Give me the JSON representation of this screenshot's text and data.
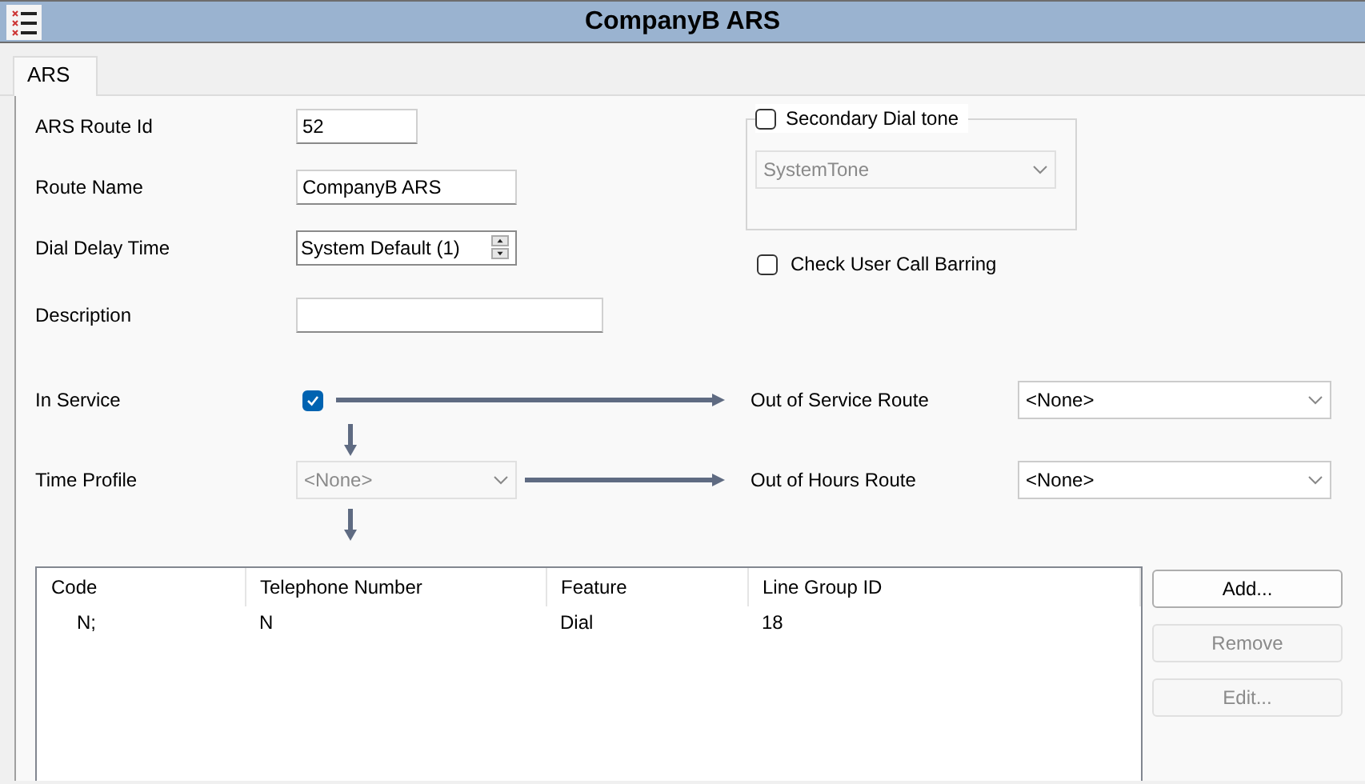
{
  "window": {
    "title": "CompanyB ARS"
  },
  "tabs": [
    {
      "label": "ARS",
      "selected": true
    }
  ],
  "fields": [
    {
      "label": "ARS Route Id",
      "kind": "text",
      "value": "52"
    },
    {
      "label": "Route Name",
      "kind": "text",
      "value": "CompanyB ARS"
    },
    {
      "label": "Dial Delay Time",
      "kind": "spin",
      "value": "System Default (1)"
    },
    {
      "label": "Description",
      "kind": "text"
    }
  ],
  "secondary_dial_tone": {
    "label": "Secondary Dial tone",
    "checked": false,
    "select": {
      "value": "SystemTone",
      "disabled": true
    }
  },
  "check_user_call_barring": {
    "label": "Check User Call Barring",
    "checked": false
  },
  "in_service": {
    "label": "In Service",
    "checked": true
  },
  "out_of_service_route": {
    "label": "Out of Service Route",
    "value": "<None>"
  },
  "time_profile": {
    "label": "Time Profile",
    "value": "<None>",
    "disabled": true
  },
  "out_of_hours_route": {
    "label": "Out of Hours Route",
    "value": "<None>"
  },
  "table": {
    "columns": [
      "Code",
      "Telephone Number",
      "Feature",
      "Line Group ID"
    ],
    "rows": [
      [
        "N;",
        "N",
        "Dial",
        "18"
      ]
    ]
  },
  "buttons": [
    {
      "label": "Add...",
      "disabled": false
    },
    {
      "label": "Remove",
      "disabled": true
    },
    {
      "label": "Edit...",
      "disabled": true
    }
  ]
}
